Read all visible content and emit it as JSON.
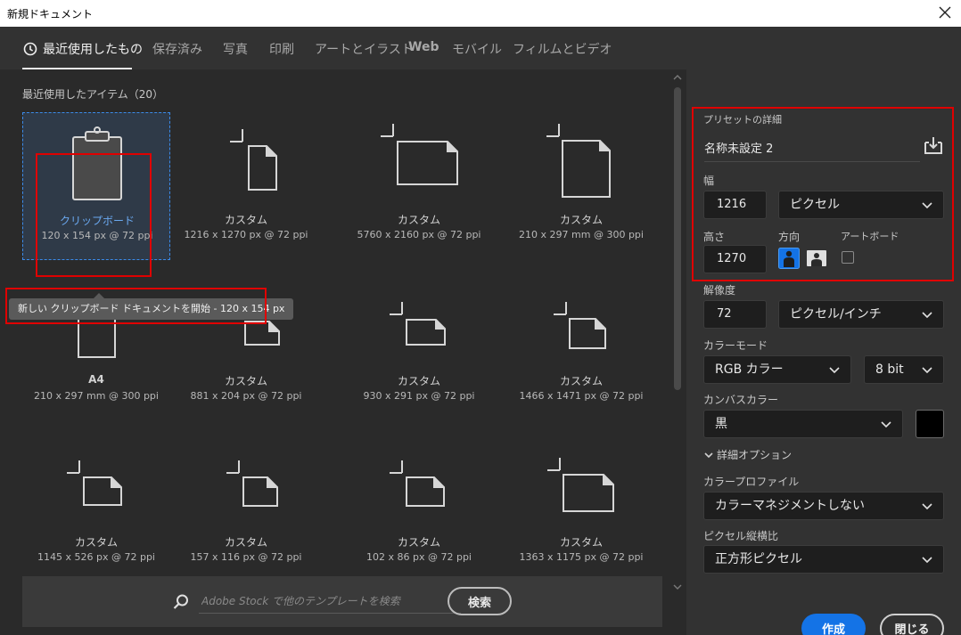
{
  "window": {
    "title": "新規ドキュメント"
  },
  "tabs": [
    {
      "label": "最近使用したもの",
      "active": true
    },
    {
      "label": "保存済み"
    },
    {
      "label": "写真"
    },
    {
      "label": "印刷"
    },
    {
      "label": "アートとイラスト"
    },
    {
      "label": "Web"
    },
    {
      "label": "モバイル"
    },
    {
      "label": "フィルムとビデオ"
    }
  ],
  "recent": {
    "heading": "最近使用したアイテム（20）",
    "items": [
      {
        "name": "クリップボード",
        "dims": "120 x 154 px @ 72 ppi",
        "icon": "clipboard-icon"
      },
      {
        "name": "カスタム",
        "dims": "1216 x 1270 px @ 72 ppi",
        "icon": "document-icon"
      },
      {
        "name": "カスタム",
        "dims": "5760 x 2160 px @ 72 ppi",
        "icon": "document-icon"
      },
      {
        "name": "カスタム",
        "dims": "210 x 297 mm @ 300 ppi",
        "icon": "document-icon"
      },
      {
        "name": "A4",
        "dims": "210 x 297 mm @ 300 ppi",
        "icon": "document-icon"
      },
      {
        "name": "カスタム",
        "dims": "881 x 204 px @ 72 ppi",
        "icon": "document-icon"
      },
      {
        "name": "カスタム",
        "dims": "930 x 291 px @ 72 ppi",
        "icon": "document-icon"
      },
      {
        "name": "カスタム",
        "dims": "1466 x 1471 px @ 72 ppi",
        "icon": "document-icon"
      },
      {
        "name": "カスタム",
        "dims": "1145 x 526 px @ 72 ppi",
        "icon": "document-icon"
      },
      {
        "name": "カスタム",
        "dims": "157 x 116 px @ 72 ppi",
        "icon": "document-icon"
      },
      {
        "name": "カスタム",
        "dims": "102 x 86 px @ 72 ppi",
        "icon": "document-icon"
      },
      {
        "name": "カスタム",
        "dims": "1363 x 1175 px @ 72 ppi",
        "icon": "document-icon"
      }
    ],
    "tooltip": "新しい クリップボード ドキュメントを開始 - 120 x 154 px"
  },
  "search": {
    "placeholder": "Adobe Stock で他のテンプレートを検索",
    "button_label": "検索"
  },
  "preset": {
    "heading": "プリセットの詳細",
    "name": "名称未設定 2",
    "width_label": "幅",
    "width_value": "1216",
    "width_unit": "ピクセル",
    "height_label": "高さ",
    "height_value": "1270",
    "orientation_label": "方向",
    "artboard_label": "アートボード",
    "resolution_label": "解像度",
    "resolution_value": "72",
    "resolution_unit": "ピクセル/インチ",
    "color_mode_label": "カラーモード",
    "color_mode_value": "RGB カラー",
    "bit_depth_value": "8 bit",
    "canvas_color_label": "カンバスカラー",
    "canvas_color_value": "黒",
    "canvas_color_swatch": "#000000",
    "advanced_label": "詳細オプション",
    "color_profile_label": "カラープロファイル",
    "color_profile_value": "カラーマネジメントしない",
    "pixel_aspect_label": "ピクセル縦横比",
    "pixel_aspect_value": "正方形ピクセル"
  },
  "actions": {
    "create_label": "作成",
    "close_label": "閉じる"
  },
  "colors": {
    "accent": "#1473e6",
    "highlight_border": "#e00000",
    "selection": "#3b8bea"
  }
}
